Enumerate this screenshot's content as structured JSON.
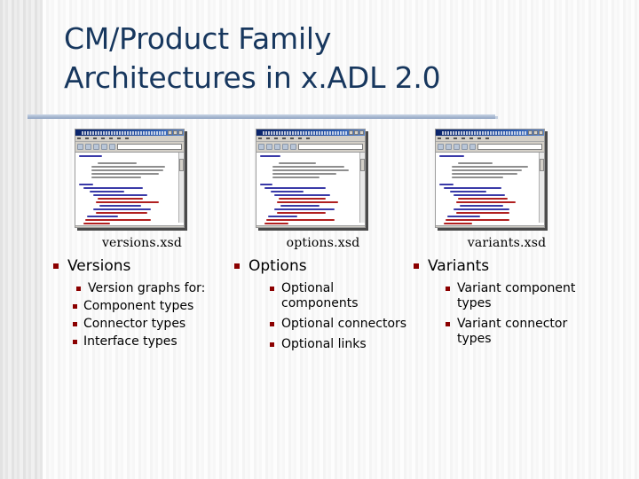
{
  "slide": {
    "title": "CM/Product Family\nArchitectures in x.ADL 2.0",
    "accent_color": "#17375e",
    "bullet_color": "#8b0000",
    "divider_color": "#8fa4c2",
    "background_color": "#fbfbfb"
  },
  "columns": [
    {
      "caption": "versions.xsd",
      "heading": "Versions",
      "sub": [
        {
          "label": "Version graphs for:",
          "children": [
            "Component types",
            "Connector types",
            "Interface types"
          ]
        }
      ]
    },
    {
      "caption": "options.xsd",
      "heading": "Options",
      "sub": [
        {
          "label": "Optional components",
          "children": []
        },
        {
          "label": "Optional connectors",
          "children": []
        },
        {
          "label": "Optional links",
          "children": []
        }
      ]
    },
    {
      "caption": "variants.xsd",
      "heading": "Variants",
      "sub": [
        {
          "label": "Variant component types",
          "children": []
        },
        {
          "label": "Variant connector types",
          "children": []
        }
      ]
    }
  ],
  "thumbnail": {
    "window_kind": "internet-explorer-window",
    "content_kind": "xml-schema-source"
  }
}
